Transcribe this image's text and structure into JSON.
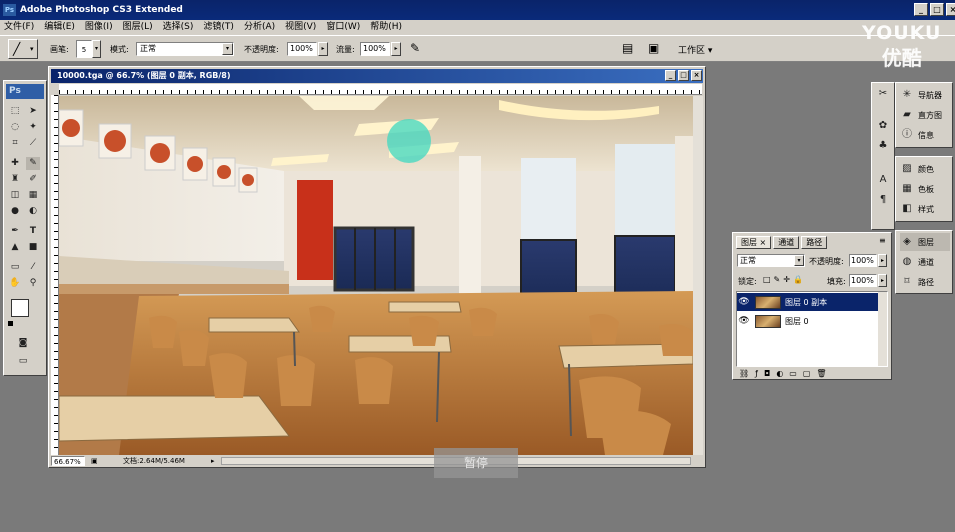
{
  "app": {
    "title": "Adobe Photoshop CS3 Extended",
    "icon_label": "Ps",
    "window_buttons": [
      "_",
      "□",
      "×"
    ]
  },
  "menu": [
    "文件(F)",
    "编辑(E)",
    "图像(I)",
    "图层(L)",
    "选择(S)",
    "滤镜(T)",
    "分析(A)",
    "视图(V)",
    "窗口(W)",
    "帮助(H)"
  ],
  "options": {
    "brush_label": "画笔:",
    "brush_size": "5",
    "mode_label": "模式:",
    "mode_value": "正常",
    "opacity_label": "不透明度:",
    "opacity_value": "100%",
    "flow_label": "流量:",
    "flow_value": "100%",
    "workspace_label": "工作区 ▾"
  },
  "toolbox": {
    "logo": "Ps",
    "tools": [
      "marquee-tool",
      "move-tool",
      "lasso-tool",
      "magic-wand-tool",
      "crop-tool",
      "slice-tool",
      "healing-tool",
      "brush-tool",
      "stamp-tool",
      "history-brush-tool",
      "eraser-tool",
      "gradient-tool",
      "blur-tool",
      "dodge-tool",
      "pen-tool",
      "type-tool",
      "path-select-tool",
      "shape-tool",
      "notes-tool",
      "eyedropper-tool",
      "hand-tool",
      "zoom-tool"
    ]
  },
  "document": {
    "title": "10000.tga @ 66.7% (图层 0 副本, RGB/8)",
    "zoom": "66.67%",
    "doc_info": "文档:2.64M/5.46M"
  },
  "side_panel_group1": [
    {
      "icon": "navigator-icon",
      "label": "导航器"
    },
    {
      "icon": "histogram-icon",
      "label": "直方图"
    },
    {
      "icon": "info-icon",
      "label": "信息"
    }
  ],
  "side_panel_group2": [
    {
      "icon": "color-icon",
      "label": "颜色"
    },
    {
      "icon": "swatches-icon",
      "label": "色板"
    },
    {
      "icon": "styles-icon",
      "label": "样式"
    }
  ],
  "side_panel_group3": [
    {
      "icon": "layers-icon",
      "label": "图层"
    },
    {
      "icon": "channels-icon",
      "label": "通道"
    },
    {
      "icon": "paths-icon",
      "label": "路径"
    }
  ],
  "layers_panel": {
    "tabs": [
      "图层 ×",
      "通道",
      "路径"
    ],
    "blend_mode": "正常",
    "opacity_label": "不透明度:",
    "opacity_value": "100%",
    "lock_label": "锁定:",
    "fill_label": "填充:",
    "fill_value": "100%",
    "layers": [
      {
        "name": "图层 0 副本",
        "selected": true
      },
      {
        "name": "图层 0",
        "selected": false
      }
    ]
  },
  "overlay": {
    "pause_label": "暂停",
    "watermark_top": "YOUKU",
    "watermark_bottom": "优酷"
  },
  "colors": {
    "titlebar": "#0a246a",
    "chrome": "#d4d0c8",
    "workspace": "#7a7a7a",
    "selected_layer": "#0a246a"
  }
}
